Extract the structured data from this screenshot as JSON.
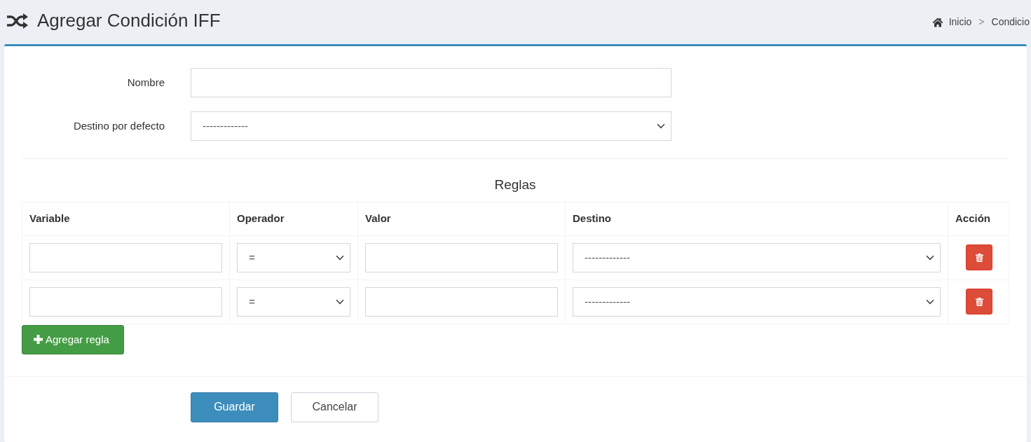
{
  "header": {
    "title": "Agregar Condición IFF"
  },
  "breadcrumb": {
    "separator": ">",
    "items": [
      {
        "label": "Inicio",
        "kind": "home"
      },
      {
        "label": "Condicio",
        "kind": "plain"
      }
    ]
  },
  "form": {
    "fields": [
      {
        "label": "Nombre",
        "kind": "text"
      },
      {
        "label": "Destino por defecto",
        "kind": "select",
        "value": "-------------"
      }
    ]
  },
  "rules": {
    "title": "Reglas",
    "columns": [
      "Variable",
      "Operador",
      "Valor",
      "Destino",
      "Acción"
    ],
    "rows": [
      {
        "operator": "=",
        "destination": "-------------"
      },
      {
        "operator": "=",
        "destination": "-------------"
      }
    ],
    "add_button": "Agregar regla"
  },
  "buttons": [
    {
      "label": "Guardar",
      "kind": "primary"
    },
    {
      "label": "Cancelar",
      "kind": "default"
    }
  ]
}
